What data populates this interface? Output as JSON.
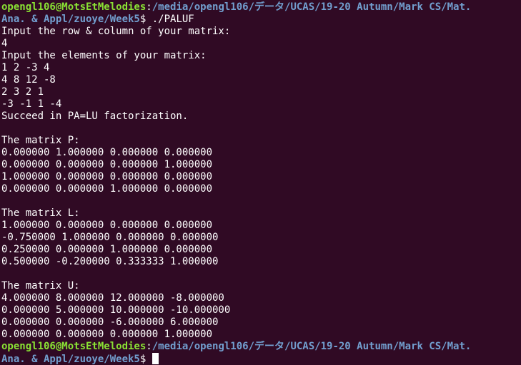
{
  "colors": {
    "background": "#300a24",
    "text": "#ffffff",
    "prompt_user": "#8ae234",
    "prompt_path": "#729fcf"
  },
  "prompt1": {
    "user_host": "opengl106@MotsEtMelodies",
    "colon": ":",
    "path_line1": "/media/opengl106/データ/UCAS/19-20 Autumn/Mark CS/Mat.",
    "path_line2": "Ana. & Appl/zuoye/Week5",
    "dollar": "$ ",
    "command": "./PALUF"
  },
  "output": [
    "Input the row & column of your matrix:",
    "4",
    "Input the elements of your matrix:",
    "1 2 -3 4",
    "4 8 12 -8",
    "2 3 2 1",
    "-3 -1 1 -4",
    "Succeed in PA=LU factorization.",
    "",
    "The matrix P:",
    "0.000000 1.000000 0.000000 0.000000",
    "0.000000 0.000000 0.000000 1.000000",
    "1.000000 0.000000 0.000000 0.000000",
    "0.000000 0.000000 1.000000 0.000000",
    "",
    "The matrix L:",
    "1.000000 0.000000 0.000000 0.000000",
    "-0.750000 1.000000 0.000000 0.000000",
    "0.250000 0.000000 1.000000 0.000000",
    "0.500000 -0.200000 0.333333 1.000000",
    "",
    "The matrix U:",
    "4.000000 8.000000 12.000000 -8.000000",
    "0.000000 5.000000 10.000000 -10.000000",
    "0.000000 0.000000 -6.000000 6.000000",
    "0.000000 0.000000 0.000000 1.000000"
  ],
  "prompt2": {
    "user_host": "opengl106@MotsEtMelodies",
    "colon": ":",
    "path_line1": "/media/opengl106/データ/UCAS/19-20 Autumn/Mark CS/Mat.",
    "path_line2": "Ana. & Appl/zuoye/Week5",
    "dollar": "$ "
  }
}
